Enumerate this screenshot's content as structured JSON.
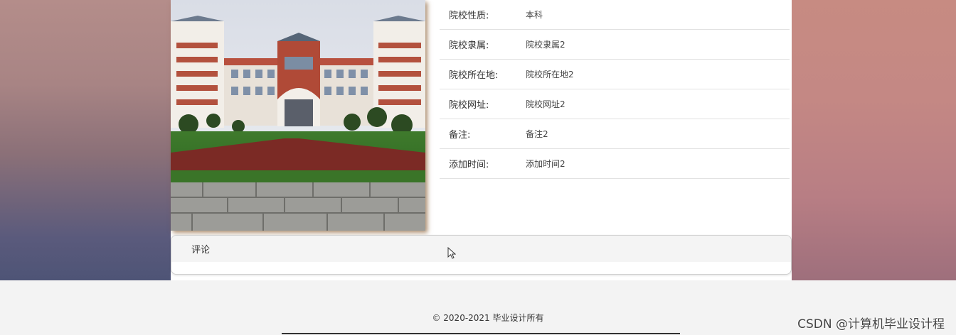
{
  "details": {
    "rows": [
      {
        "label": "院校性质:",
        "value": "本科"
      },
      {
        "label": "院校隶属:",
        "value": "院校隶属2"
      },
      {
        "label": "院校所在地:",
        "value": "院校所在地2"
      },
      {
        "label": "院校网址:",
        "value": "院校网址2"
      },
      {
        "label": "备注:",
        "value": "备注2"
      },
      {
        "label": "添加时间:",
        "value": "添加时间2"
      }
    ]
  },
  "comments": {
    "title": "评论"
  },
  "footer": {
    "copyright": "© 2020-2021 毕业设计所有",
    "watermark": "CSDN @计算机毕业设计程"
  }
}
